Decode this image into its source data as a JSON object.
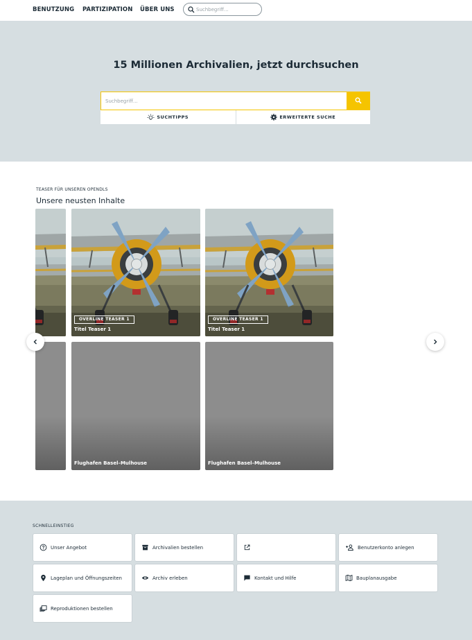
{
  "header": {
    "nav": [
      "BENUTZUNG",
      "PARTIZIPATION",
      "ÜBER UNS"
    ],
    "search_placeholder": "Suchbegriff..."
  },
  "hero": {
    "title": "15 Millionen Archivalien, jetzt durchsuchen",
    "search_placeholder": "Suchbegriff...",
    "options": [
      "SUCHTIPPS",
      "ERWEITERTE SUCHE"
    ]
  },
  "teasers": {
    "overline": "TEASER FÜR UNSEREN OPENDLS",
    "title": "Unsere neusten Inhalte",
    "cards": [
      {
        "overline": "OVERLINE TEASER 1",
        "title": "Titel Teaser 1"
      },
      {
        "overline": "OVERLINE TEASER 1",
        "title": "Titel Teaser 1"
      }
    ],
    "gray_cards": [
      {
        "title": "Flughafen Basel–Mulhouse"
      },
      {
        "title": "Flughafen Basel–Mulhouse"
      }
    ]
  },
  "quick_access": {
    "overline": "SCHNELLEINSTIEG",
    "tiles": [
      {
        "label": "Unser Angebot",
        "icon": "question-circle-icon"
      },
      {
        "label": "Archivalien bestellen",
        "icon": "archive-box-icon"
      },
      {
        "label": "",
        "icon": "external-link-icon"
      },
      {
        "label": "Benutzerkonto anlegen",
        "icon": "add-user-icon"
      },
      {
        "label": "Lageplan und Öffnungszeiten",
        "icon": "map-pin-icon"
      },
      {
        "label": "Archiv erleben",
        "icon": "eye-icon"
      },
      {
        "label": "Kontakt und Hilfe",
        "icon": "chat-icon"
      },
      {
        "label": "Bauplanausgabe",
        "icon": "map-icon"
      },
      {
        "label": "Reproduktionen bestellen",
        "icon": "copies-icon"
      }
    ]
  },
  "colors": {
    "accent": "#f5c400",
    "section_background": "#d6dee1",
    "text": "#1c2b36"
  }
}
